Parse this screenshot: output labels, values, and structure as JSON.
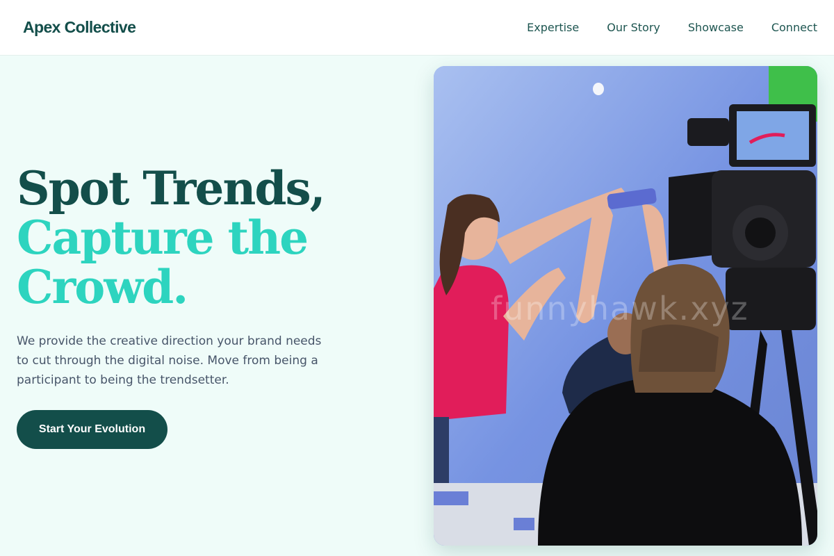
{
  "header": {
    "brand": "Apex Collective",
    "nav": [
      "Expertise",
      "Our Story",
      "Showcase",
      "Connect"
    ]
  },
  "hero": {
    "headline_line1": "Spot Trends,",
    "headline_line2a": "Capture the",
    "headline_line2b": "Crowd.",
    "description": "We provide the creative direction your brand needs to cut through the digital noise. Move from being a participant to being the trendsetter.",
    "cta_label": "Start Your Evolution"
  },
  "image": {
    "alt": "Film crew operating a camera in front of a blue backdrop while a person in a red shirt gestures",
    "watermark": "funnyhawk.xyz"
  },
  "colors": {
    "primary": "#134e4a",
    "accent": "#2dd4bf",
    "background": "#effcf9",
    "text_muted": "#475569"
  }
}
